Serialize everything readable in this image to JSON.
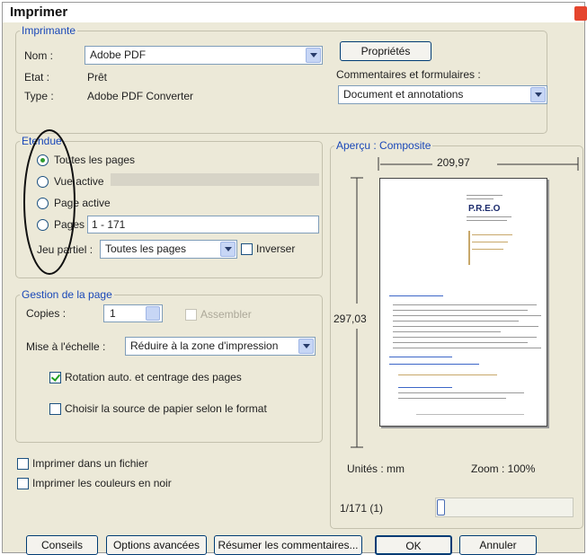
{
  "dialog": {
    "title": "Imprimer"
  },
  "printer": {
    "legend": "Imprimante",
    "name_label": "Nom :",
    "name_value": "Adobe PDF",
    "status_label": "Etat :",
    "status_value": "Prêt",
    "type_label": "Type :",
    "type_value": "Adobe PDF Converter",
    "properties_button": "Propriétés",
    "comments_label": "Commentaires et formulaires :",
    "comments_value": "Document et annotations"
  },
  "range": {
    "legend": "Etendue",
    "all_pages": "Toutes les pages",
    "current_view": "Vue active",
    "current_page": "Page active",
    "pages": "Pages",
    "pages_value": "1 - 171",
    "subset_label": "Jeu partiel :",
    "subset_value": "Toutes les pages",
    "reverse_label": "Inverser"
  },
  "handling": {
    "legend": "Gestion de la page",
    "copies_label": "Copies :",
    "copies_value": "1",
    "collate_label": "Assembler",
    "scaling_label": "Mise à l'échelle :",
    "scaling_value": "Réduire à la zone d'impression",
    "autorotate_label": "Rotation auto. et centrage des pages",
    "paper_source_label": "Choisir la source de papier selon le format"
  },
  "options": {
    "print_to_file": "Imprimer dans un fichier",
    "print_color_as_black": "Imprimer les couleurs en noir"
  },
  "preview": {
    "legend": "Aperçu : Composite",
    "width": "209,97",
    "height": "297,03",
    "units": "Unités : mm",
    "zoom": "Zoom : 100%",
    "page_indicator": "1/171 (1)",
    "slider_level": 0
  },
  "buttons": {
    "tips": "Conseils",
    "advanced": "Options avancées",
    "summarize": "Résumer les commentaires...",
    "ok": "OK",
    "cancel": "Annuler"
  }
}
